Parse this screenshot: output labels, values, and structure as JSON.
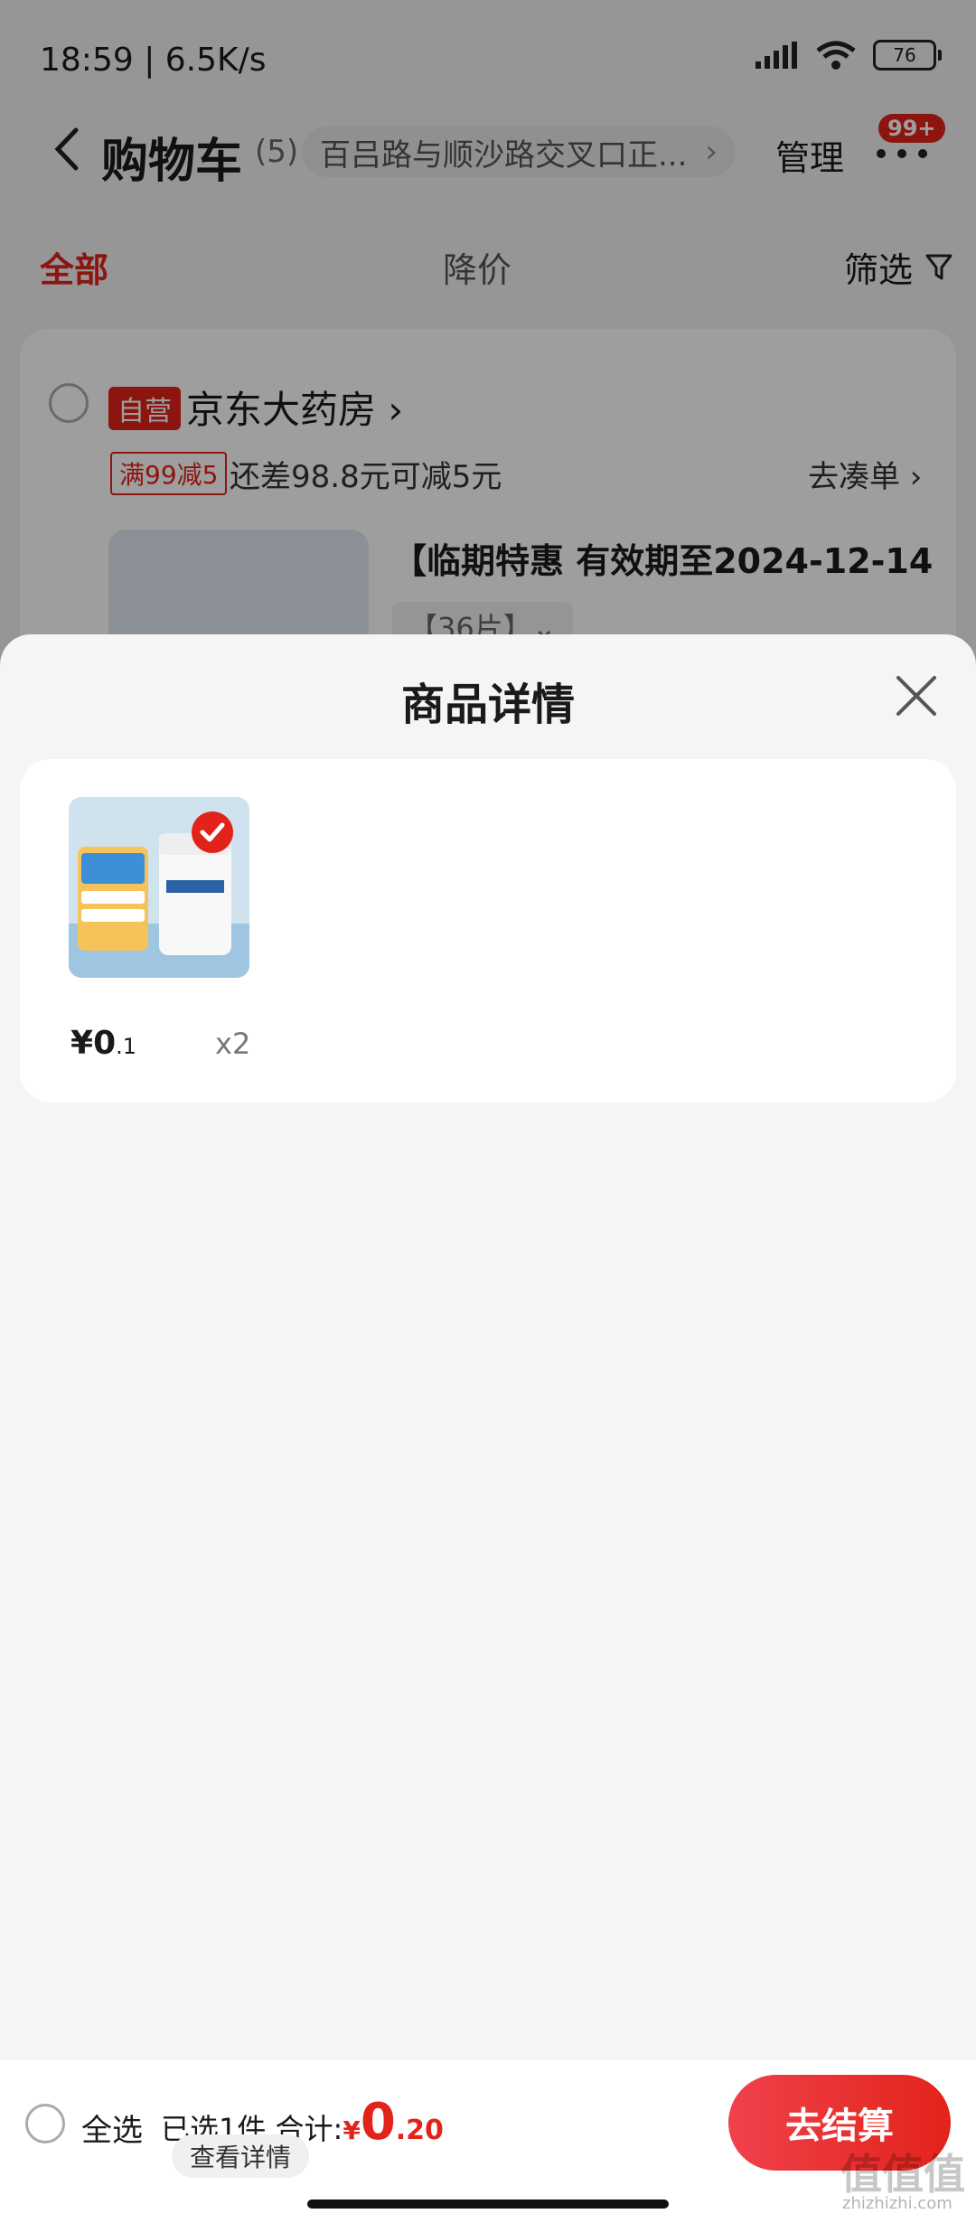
{
  "status_bar": {
    "time": "18:59 | 6.5K/s",
    "battery": "76"
  },
  "header": {
    "title": "购物车",
    "count": "(5)",
    "address": "百吕路与顺沙路交叉口正...",
    "address_chevron": "›",
    "manage": "管理",
    "badge": "99+"
  },
  "tabs": {
    "all": "全部",
    "price_drop": "降价",
    "filter": "筛选"
  },
  "store": {
    "tag": "自营",
    "name": "京东大药房 ›",
    "promo_tag": "满99减5",
    "promo_text": "还差98.8元可减5元",
    "gather": "去凑单 ›",
    "product_title": "【临期特惠 有效期至2024-12-14",
    "product_spec": "【36片】⌄"
  },
  "sheet": {
    "title": "商品详情",
    "item": {
      "currency": "¥",
      "price_int": "0",
      "price_dec": ".1",
      "qty": "x2"
    }
  },
  "bottom_bar": {
    "select_all": "全选",
    "summary_prefix": "已选1件,合计:",
    "total_currency": "¥",
    "total_int": "0",
    "total_dec": ".20",
    "detail": "查看详情",
    "checkout": "去结算"
  },
  "watermark": {
    "text": "值值值",
    "url": "zhizhizhi.com"
  },
  "colors": {
    "accent": "#e2231a"
  }
}
